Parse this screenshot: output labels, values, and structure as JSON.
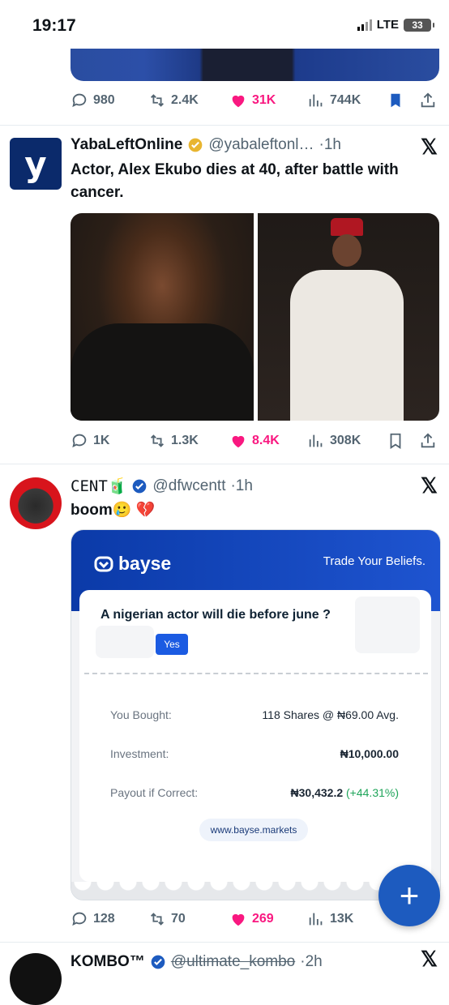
{
  "status_bar": {
    "time": "19:17",
    "network": "LTE",
    "battery": "33"
  },
  "tweet0": {
    "replies": "980",
    "retweets": "2.4K",
    "likes": "31K",
    "views": "744K",
    "bookmarked": true
  },
  "tweet1": {
    "name": "YabaLeftOnline",
    "handle": "@yabaleftonl…",
    "time": "·1h",
    "text": "Actor, Alex Ekubo dies at 40, after battle with cancer.",
    "replies": "1K",
    "retweets": "1.3K",
    "likes": "8.4K",
    "views": "308K"
  },
  "tweet2": {
    "name": "CENT🧃",
    "handle": "@dfwcentt",
    "time": "·1h",
    "text": "boom🥲 💔",
    "replies": "128",
    "retweets": "70",
    "likes": "269",
    "views": "13K",
    "card": {
      "brand": "bayse",
      "tagline": "Trade Your Beliefs.",
      "question": "A nigerian actor will die before june ?",
      "choice": "Yes",
      "rows": [
        {
          "label": "You Bought:",
          "value": "118 Shares @ ₦69.00 Avg."
        },
        {
          "label": "Investment:",
          "value": "₦10,000.00"
        },
        {
          "label": "Payout if Correct:",
          "value": "₦30,432.2",
          "extra": "(+44.31%)"
        }
      ],
      "site": "www.bayse.markets"
    }
  },
  "tweet3": {
    "name": "KOMBO™",
    "handle": "@ultimate_kombo",
    "time": "·2h"
  },
  "colors": {
    "like": "#f91880",
    "verified_gold": "#e8b530",
    "verified_blue": "#1d5bbf",
    "bayse_blue": "#0b3aa8"
  }
}
